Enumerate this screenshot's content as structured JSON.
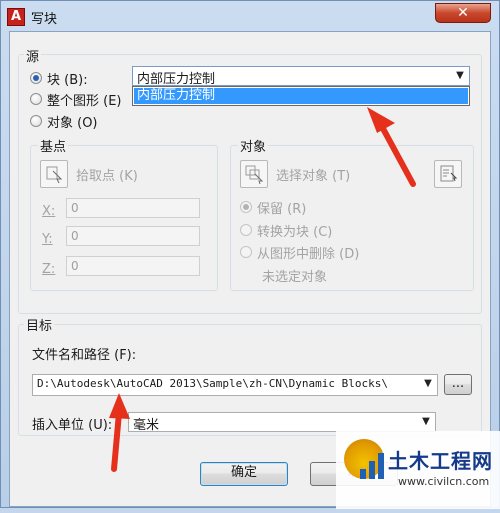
{
  "window": {
    "title": "写块",
    "close_glyph": "✕"
  },
  "source": {
    "group_label": "源",
    "radio_block": "块 (B):",
    "radio_entire": "整个图形 (E)",
    "radio_objects": "对象 (O)",
    "block_combo_value": "内部压力控制",
    "dropdown_items": [
      "内部压力控制"
    ]
  },
  "base_point": {
    "group_label": "基点",
    "pick_label": "拾取点 (K)",
    "x_label": "X:",
    "x_value": "0",
    "y_label": "Y:",
    "y_value": "0",
    "z_label": "Z:",
    "z_value": "0"
  },
  "objects": {
    "group_label": "对象",
    "select_label": "选择对象 (T)",
    "retain": "保留 (R)",
    "convert": "转换为块 (C)",
    "delete": "从图形中删除 (D)",
    "status": "未选定对象"
  },
  "destination": {
    "group_label": "目标",
    "file_label": "文件名和路径 (F):",
    "file_value": "D:\\Autodesk\\AutoCAD 2013\\Sample\\zh-CN\\Dynamic Blocks\\",
    "browse_label": "...",
    "units_label": "插入单位 (U):",
    "units_value": "毫米"
  },
  "buttons": {
    "ok": "确定",
    "cancel": "取"
  },
  "watermark": {
    "title": "土木工程网",
    "url": "www.civilcn.com"
  },
  "colors": {
    "annotation_arrow": "#e5301c",
    "selection": "#3399ff"
  }
}
